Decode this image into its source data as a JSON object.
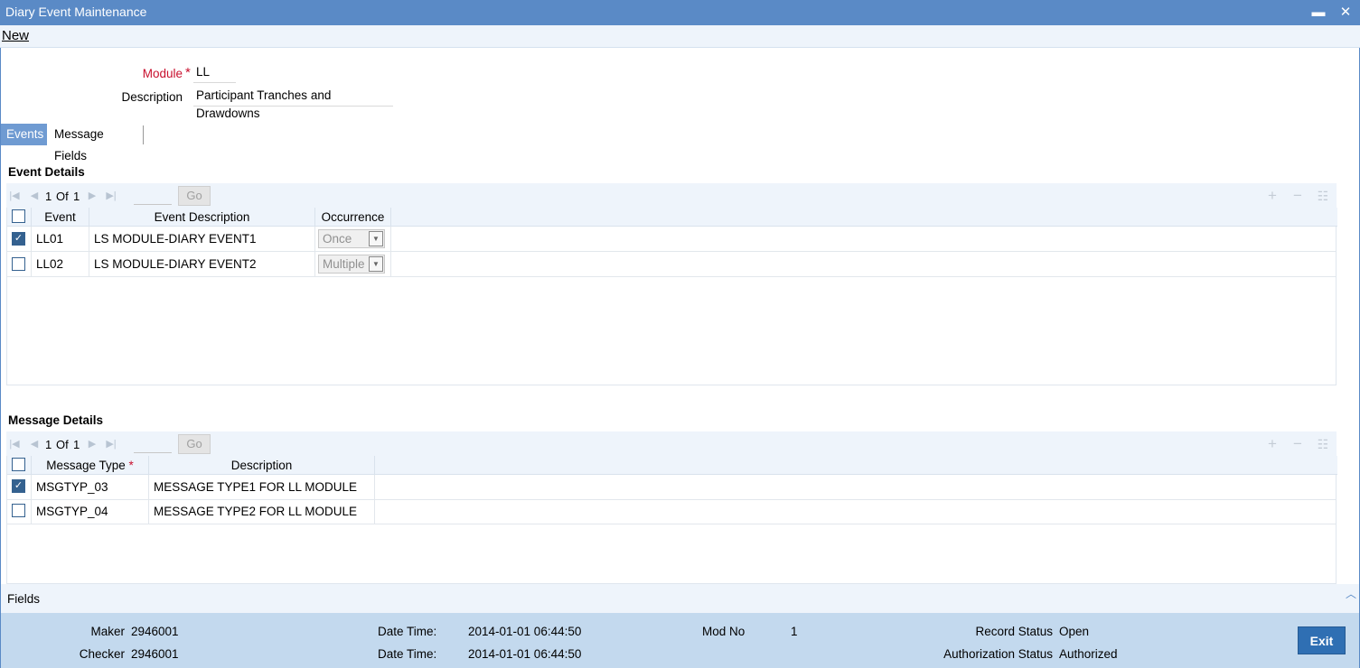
{
  "window": {
    "title": "Diary Event Maintenance",
    "minimize_glyph": "▬",
    "close_glyph": "✕"
  },
  "menu": {
    "new_label": "New"
  },
  "form": {
    "module_label": "Module",
    "module_required": "*",
    "module_value": "LL",
    "description_label": "Description",
    "description_value": "Participant Tranches and Drawdowns"
  },
  "tabs": [
    {
      "label": "Events",
      "active": true
    },
    {
      "label": "Message Fields",
      "active": false
    }
  ],
  "event_details": {
    "title": "Event Details",
    "pager": {
      "current": "1",
      "of_label": "Of",
      "total": "1",
      "go_label": "Go"
    },
    "columns": {
      "event": "Event",
      "event_description": "Event Description",
      "occurrence": "Occurrence"
    },
    "rows": [
      {
        "checked": true,
        "event": "LL01",
        "description": "LS MODULE-DIARY EVENT1",
        "occurrence": "Once"
      },
      {
        "checked": false,
        "event": "LL02",
        "description": "LS MODULE-DIARY EVENT2",
        "occurrence": "Multiple"
      }
    ]
  },
  "message_details": {
    "title": "Message Details",
    "pager": {
      "current": "1",
      "of_label": "Of",
      "total": "1",
      "go_label": "Go"
    },
    "columns": {
      "message_type": "Message Type",
      "message_type_required": "*",
      "description": "Description"
    },
    "rows": [
      {
        "checked": true,
        "message_type": "MSGTYP_03",
        "description": "MESSAGE TYPE1 FOR LL MODULE"
      },
      {
        "checked": false,
        "message_type": "MSGTYP_04",
        "description": "MESSAGE TYPE2 FOR LL MODULE"
      }
    ]
  },
  "fields_bar": {
    "label": "Fields"
  },
  "footer": {
    "maker_label": "Maker",
    "maker_value": "2946001",
    "checker_label": "Checker",
    "checker_value": "2946001",
    "datetime_label": "Date Time:",
    "maker_datetime": "2014-01-01 06:44:50",
    "checker_datetime": "2014-01-01 06:44:50",
    "mod_no_label": "Mod No",
    "mod_no_value": "1",
    "record_status_label": "Record Status",
    "record_status_value": "Open",
    "auth_status_label": "Authorization Status",
    "auth_status_value": "Authorized",
    "exit_label": "Exit"
  },
  "colors": {
    "title_bar": "#5a8ac6",
    "active_tab": "#6f9bd2",
    "footer": "#c3d9ee",
    "exit_button": "#2f6fb3",
    "required": "#c8102e"
  }
}
